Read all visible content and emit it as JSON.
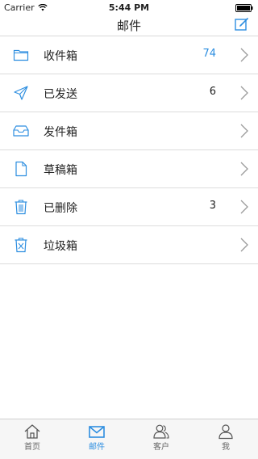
{
  "status": {
    "carrier": "Carrier",
    "time": "5:44 PM"
  },
  "nav": {
    "title": "邮件",
    "compose_icon": "compose-icon"
  },
  "colors": {
    "accent": "#2d8ee0",
    "divider": "#dcdcdc"
  },
  "folders": [
    {
      "label": "收件箱",
      "count": "74",
      "icon": "folder-icon"
    },
    {
      "label": "已发送",
      "count": "6",
      "icon": "send-icon"
    },
    {
      "label": "发件箱",
      "count": "",
      "icon": "outbox-tray-icon"
    },
    {
      "label": "草稿箱",
      "count": "",
      "icon": "draft-document-icon"
    },
    {
      "label": "已删除",
      "count": "3",
      "icon": "trash-icon"
    },
    {
      "label": "垃圾箱",
      "count": "",
      "icon": "junk-bin-icon"
    }
  ],
  "tabs": [
    {
      "label": "首页",
      "icon": "home-icon"
    },
    {
      "label": "邮件",
      "icon": "mail-icon",
      "active": true
    },
    {
      "label": "客户",
      "icon": "customers-icon"
    },
    {
      "label": "我",
      "icon": "profile-icon"
    }
  ]
}
